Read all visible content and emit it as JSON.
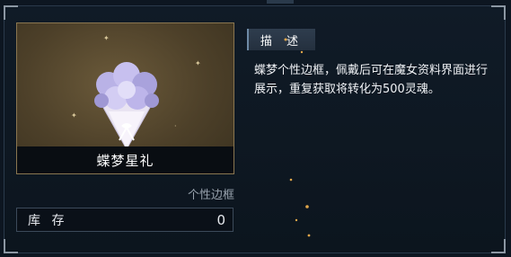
{
  "item": {
    "name": "蝶梦星礼",
    "category": "个性边框",
    "image_icon": "flower-bouquet-icon"
  },
  "stock": {
    "label": "库 存",
    "value": "0"
  },
  "description": {
    "tab_label": "描 述",
    "text": "蝶梦个性边框，佩戴后可在魔女资料界面进行展示，重复获取将转化为500灵魂。"
  },
  "colors": {
    "background": "#0d1621",
    "card_gold": "#4d4029",
    "card_border": "#8a7650",
    "text": "#e6e9ee",
    "muted_text": "#98a2ad"
  }
}
